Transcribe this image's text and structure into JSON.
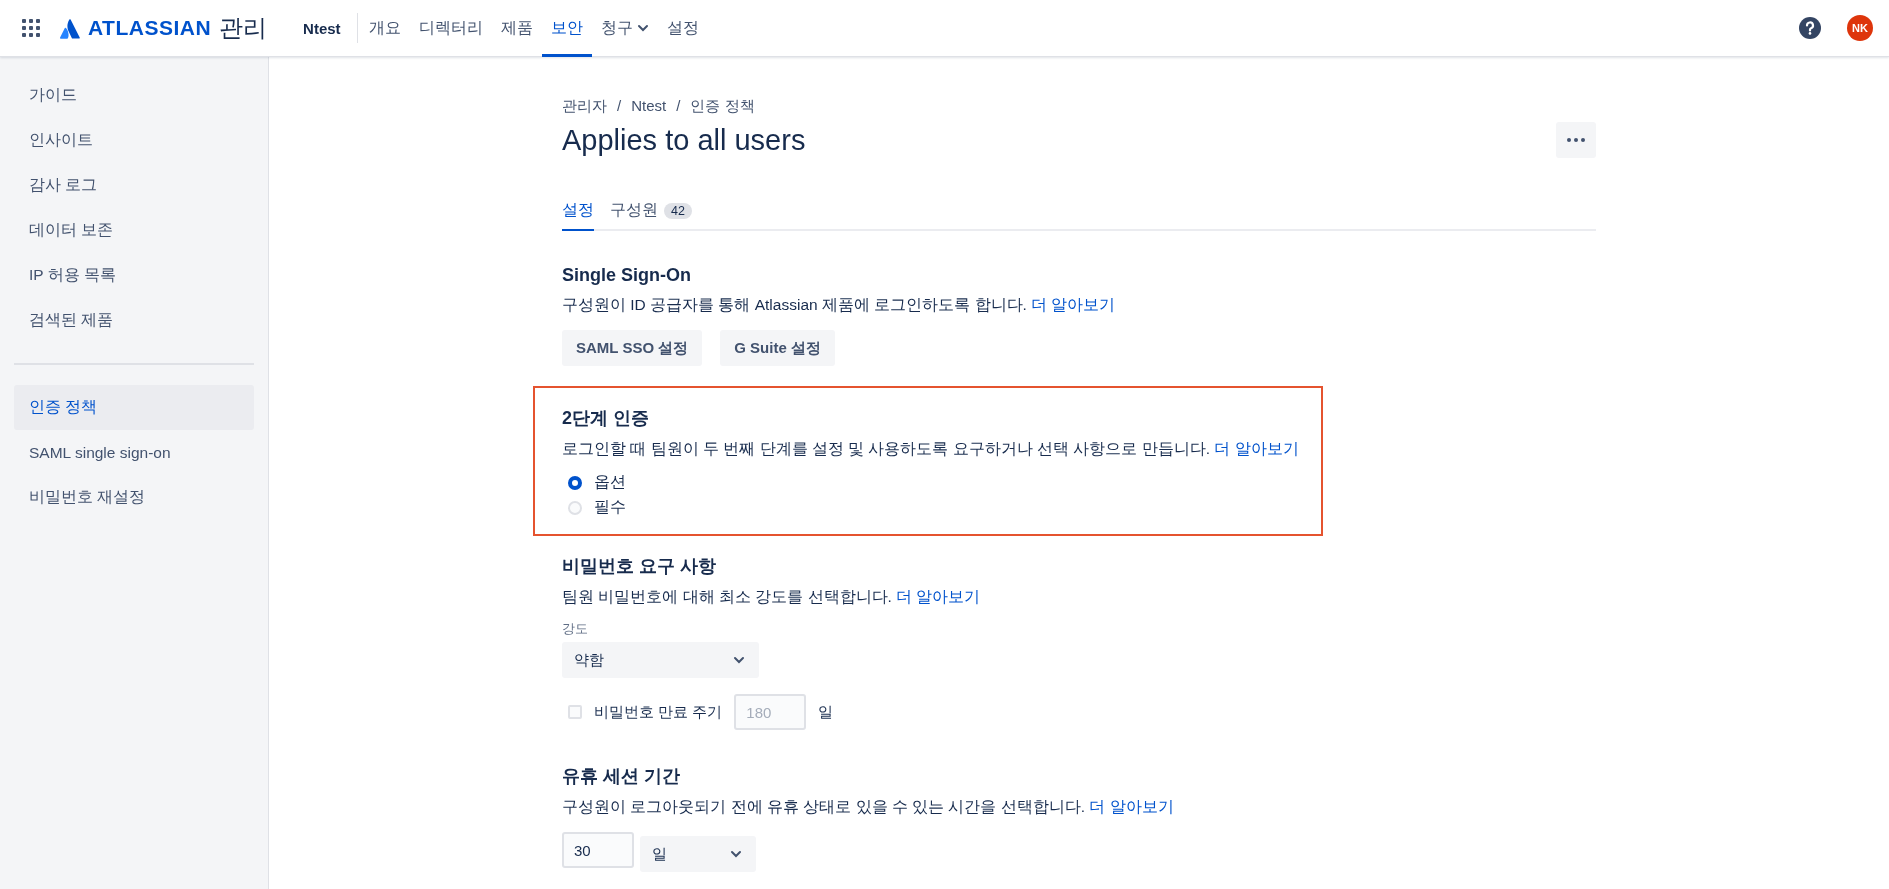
{
  "topbar": {
    "brand": "ATLASSIAN",
    "product": "관리",
    "org": "Ntest",
    "nav": [
      {
        "label": "개요",
        "selected": false,
        "dropdown": false
      },
      {
        "label": "디렉터리",
        "selected": false,
        "dropdown": false
      },
      {
        "label": "제품",
        "selected": false,
        "dropdown": false
      },
      {
        "label": "보안",
        "selected": true,
        "dropdown": false
      },
      {
        "label": "청구",
        "selected": false,
        "dropdown": true
      },
      {
        "label": "설정",
        "selected": false,
        "dropdown": false
      }
    ],
    "avatar": "NK"
  },
  "sidebar": {
    "groups": [
      [
        {
          "label": "가이드",
          "selected": false
        },
        {
          "label": "인사이트",
          "selected": false
        },
        {
          "label": "감사 로그",
          "selected": false
        },
        {
          "label": "데이터 보존",
          "selected": false
        },
        {
          "label": "IP 허용 목록",
          "selected": false
        },
        {
          "label": "검색된 제품",
          "selected": false
        }
      ],
      [
        {
          "label": "인증 정책",
          "selected": true
        },
        {
          "label": "SAML single sign-on",
          "selected": false
        },
        {
          "label": "비밀번호 재설정",
          "selected": false
        }
      ]
    ]
  },
  "breadcrumbs": [
    {
      "label": "관리자"
    },
    {
      "separator": "/",
      "label": "Ntest"
    },
    {
      "separator": "/",
      "label": "인증 정책"
    }
  ],
  "title": "Applies to all users",
  "tabs": [
    {
      "label": "설정",
      "selected": true
    },
    {
      "label": "구성원",
      "selected": false,
      "count": "42"
    }
  ],
  "sections": [
    {
      "kind": "buttons",
      "highlighted": false,
      "heading": "Single Sign-On",
      "description": "구성원이 ID 공급자를 통해 Atlassian 제품에 로그인하도록 합니다.",
      "link": "더 알아보기",
      "buttons": [
        "SAML SSO 설정",
        "G Suite 설정"
      ]
    },
    {
      "kind": "radios",
      "highlighted": true,
      "heading": "2단계 인증",
      "description": "로그인할 때 팀원이 두 번째 단계를 설정 및 사용하도록 요구하거나 선택 사항으로 만듭니다.",
      "link": "더 알아보기",
      "options": [
        {
          "label": "옵션",
          "selected": true
        },
        {
          "label": "필수",
          "selected": false
        }
      ]
    },
    {
      "kind": "password",
      "highlighted": false,
      "heading": "비밀번호 요구 사항",
      "description": "팀원 비밀번호에 대해 최소 강도를 선택합니다.",
      "link": "더 알아보기",
      "select_label": "강도",
      "select_value": "약함",
      "expiry": {
        "label": "비밀번호 만료 주기",
        "checked": false,
        "placeholder": "180",
        "unit": "일"
      }
    },
    {
      "kind": "session",
      "highlighted": false,
      "heading": "유휴 세션 기간",
      "description": "구성원이 로그아웃되기 전에 유휴 상태로 있을 수 있는 시간을 선택합니다.",
      "link": "더 알아보기",
      "value": "30",
      "unit": "일"
    }
  ]
}
